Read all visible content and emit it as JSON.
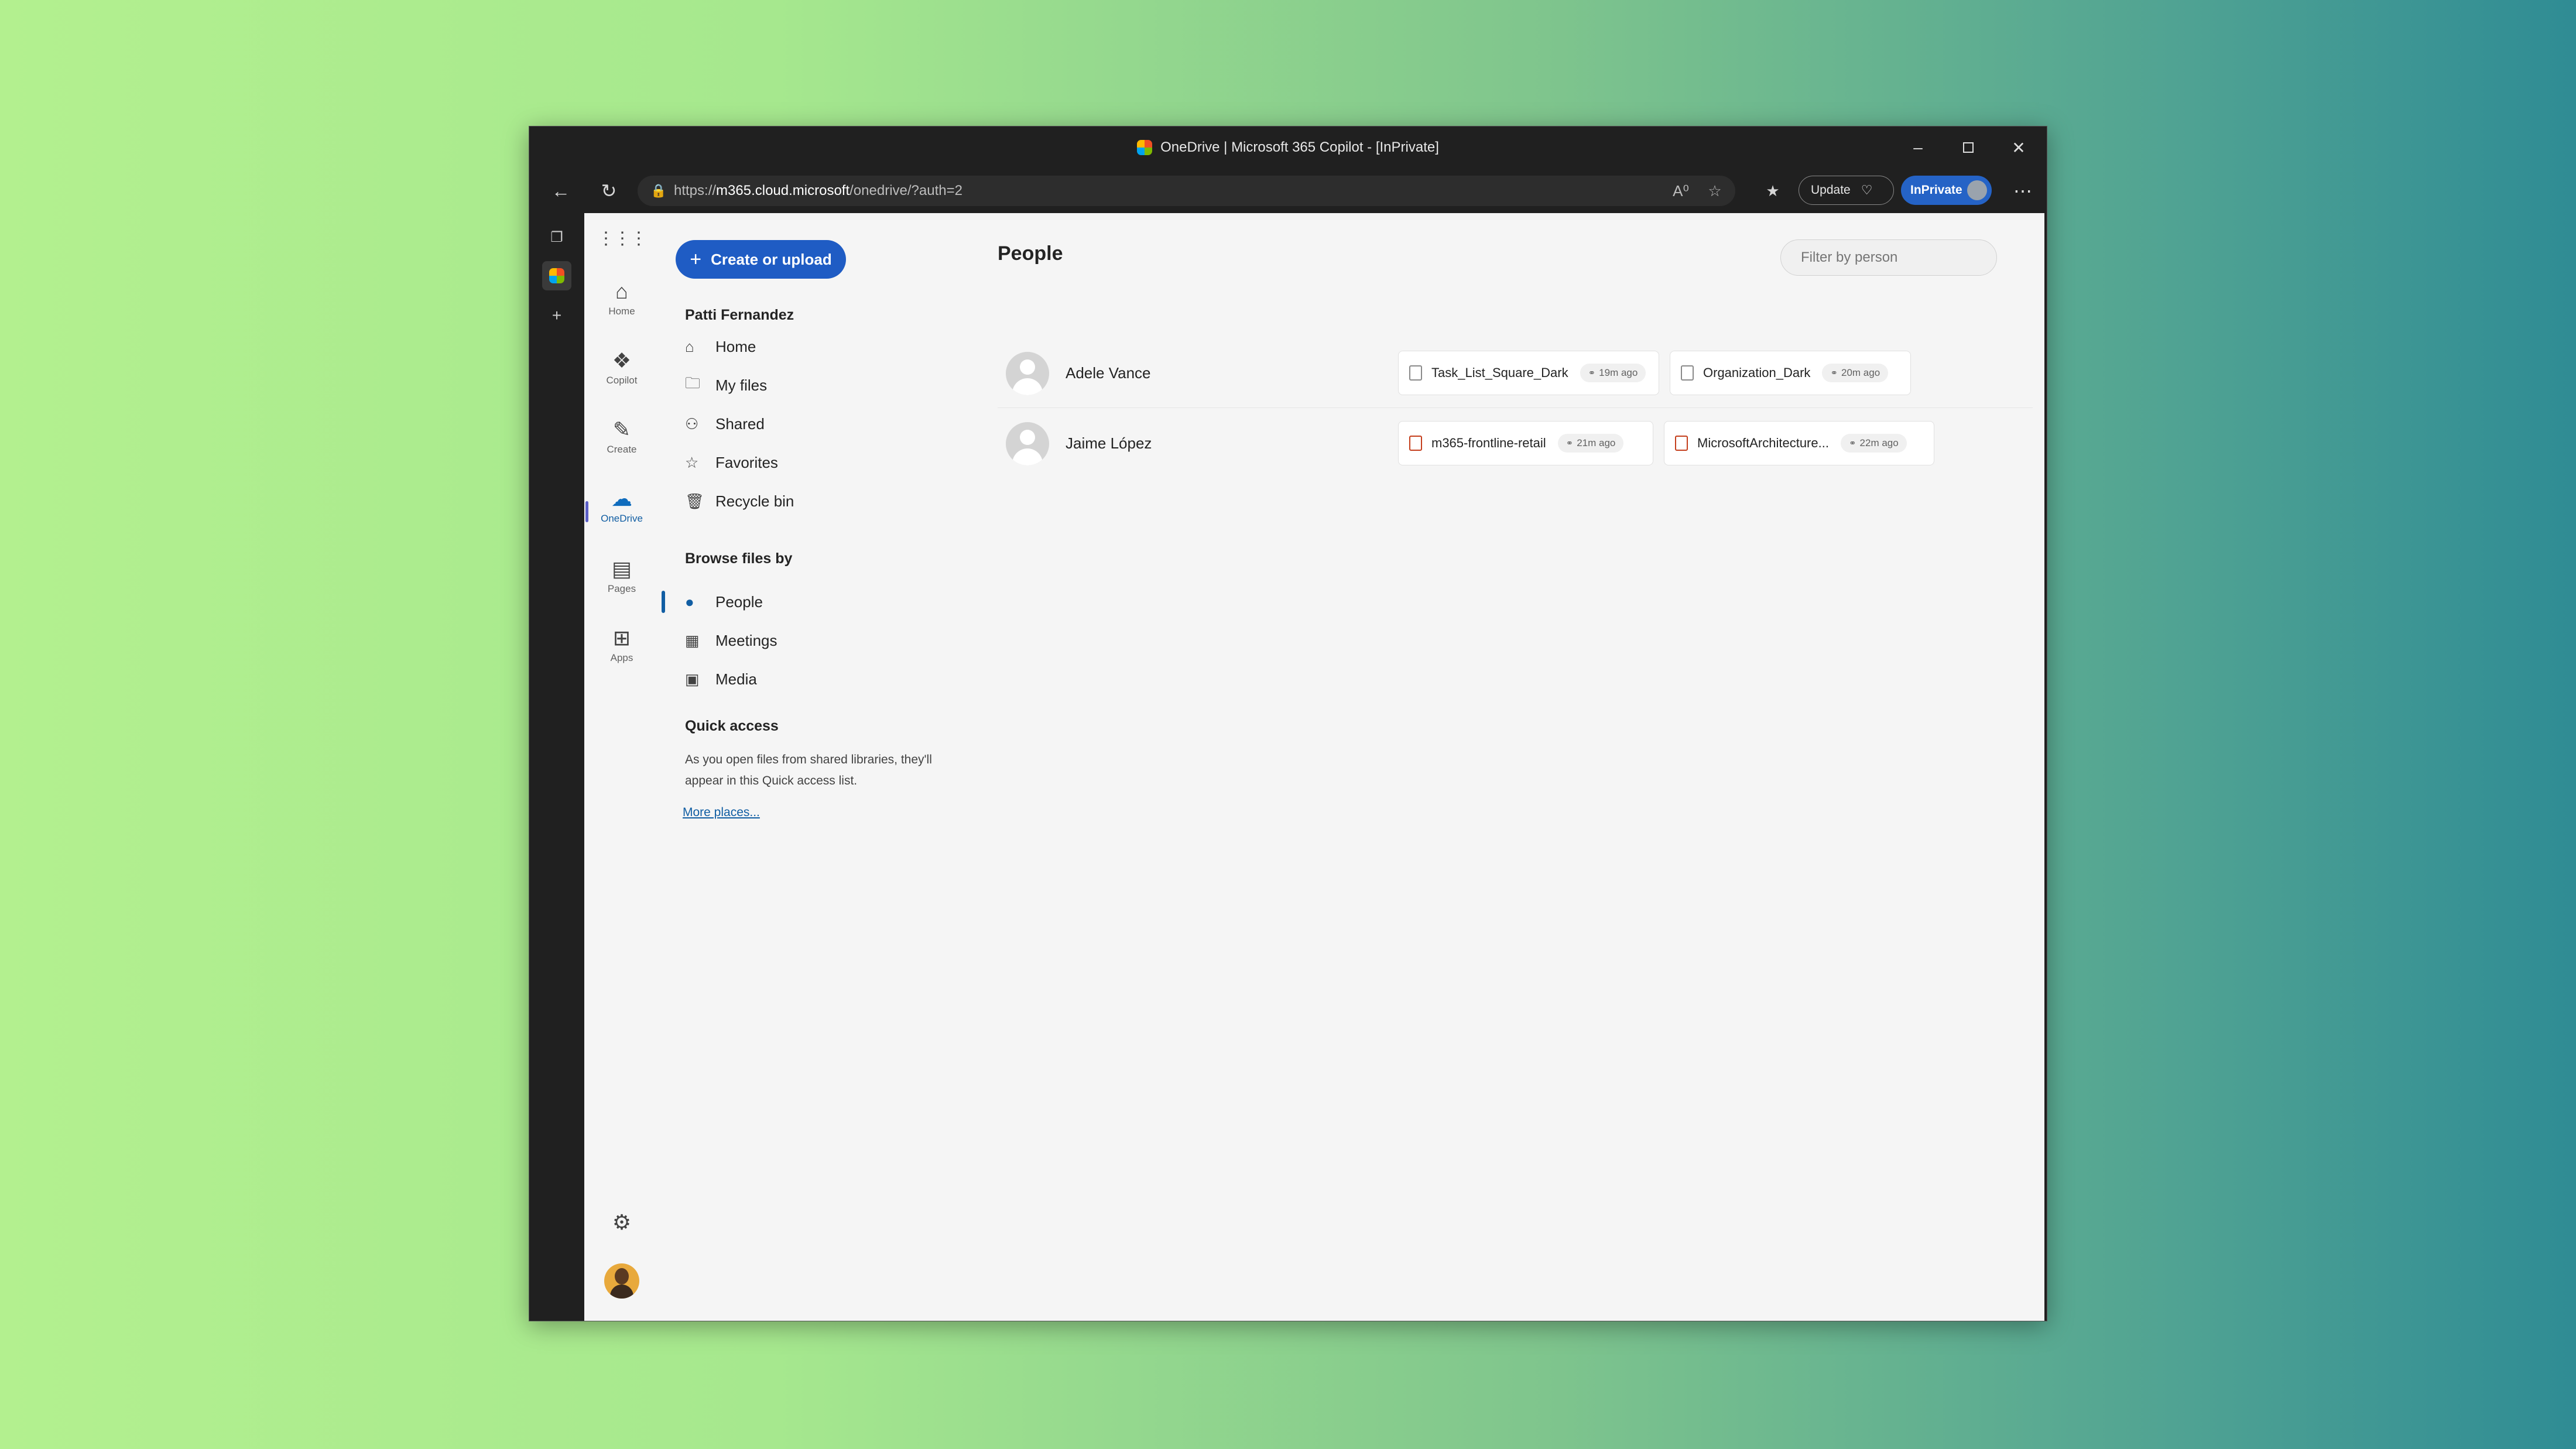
{
  "browser": {
    "title": "OneDrive | Microsoft 365 Copilot - [InPrivate]",
    "url_prefix": "https://",
    "url_host": "m365.cloud.microsoft",
    "url_path": "/onedrive/?auth=2",
    "update_label": "Update",
    "inprivate_label": "InPrivate"
  },
  "rail": {
    "items": [
      {
        "label": "Home"
      },
      {
        "label": "Copilot"
      },
      {
        "label": "Create"
      },
      {
        "label": "OneDrive"
      },
      {
        "label": "Pages"
      },
      {
        "label": "Apps"
      }
    ],
    "active": "OneDrive"
  },
  "nav": {
    "create_label": "Create or upload",
    "user_name": "Patti Fernandez",
    "items": [
      {
        "label": "Home"
      },
      {
        "label": "My files"
      },
      {
        "label": "Shared"
      },
      {
        "label": "Favorites"
      },
      {
        "label": "Recycle bin"
      }
    ],
    "browse_title": "Browse files by",
    "browse_items": [
      {
        "label": "People"
      },
      {
        "label": "Meetings"
      },
      {
        "label": "Media"
      }
    ],
    "browse_active": "People",
    "quick_access_title": "Quick access",
    "quick_access_desc": "As you open files from shared libraries, they'll appear in this Quick access list.",
    "more_places": "More places..."
  },
  "main": {
    "title": "People",
    "filter_placeholder": "Filter by person",
    "people": [
      {
        "name": "Adele Vance",
        "files": [
          {
            "name": "Task_List_Square_Dark",
            "time": "19m ago",
            "icon": "file-icon"
          },
          {
            "name": "Organization_Dark",
            "time": "20m ago",
            "icon": "file-icon"
          }
        ]
      },
      {
        "name": "Jaime López",
        "files": [
          {
            "name": "m365-frontline-retail",
            "time": "21m ago",
            "icon": "pdf-icon"
          },
          {
            "name": "MicrosoftArchitecture...",
            "time": "22m ago",
            "icon": "pdf-icon"
          }
        ]
      }
    ]
  }
}
